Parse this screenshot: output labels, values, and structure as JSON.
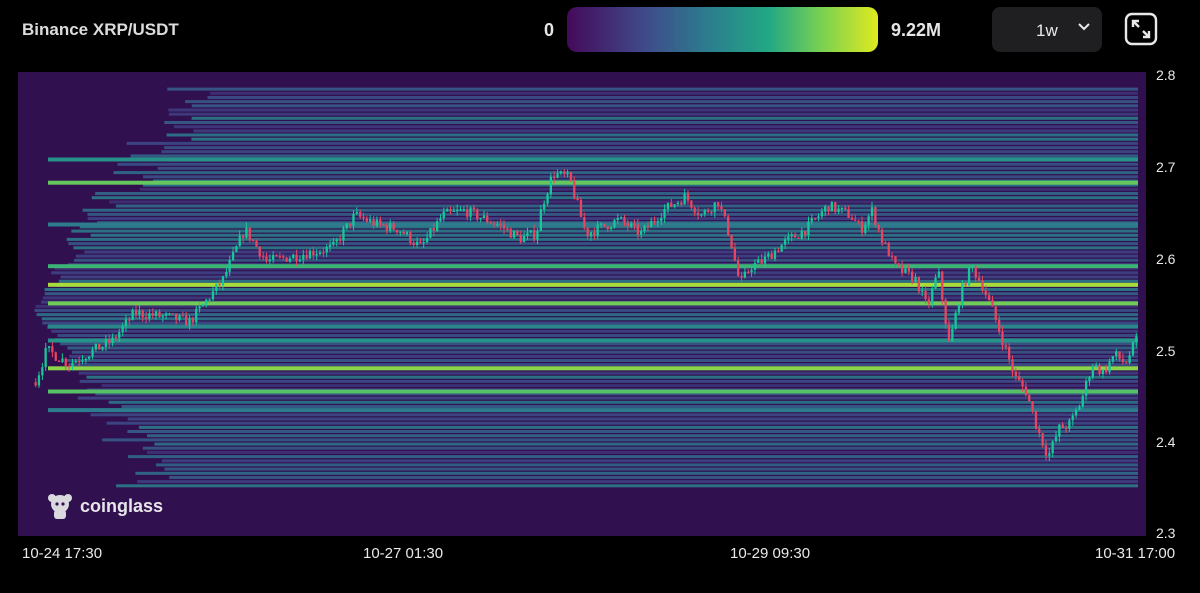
{
  "header": {
    "title": "Binance XRP/USDT",
    "scale_min_label": "0",
    "scale_max_label": "9.22M",
    "range_value": "1w"
  },
  "brand": {
    "logo_text": "coinglass"
  },
  "colors": {
    "background": "#000000",
    "plot_background": "#31104f",
    "candle_up": "#16c79a",
    "candle_down": "#e94560",
    "heat_low": "#440a5a",
    "heat_high": "#e0ea1f"
  },
  "icons": {
    "range_chevron": "chevron-down-icon",
    "fullscreen": "fullscreen-icon",
    "logo": "coinglass-logo-icon"
  },
  "chart_data": {
    "type": "heatmap",
    "title": "Binance XRP/USDT",
    "colorscale": {
      "min": 0,
      "max": 9220000,
      "min_label": "0",
      "max_label": "9.22M"
    },
    "ylim": [
      2.3,
      2.8
    ],
    "y_ticks": [
      "2.8",
      "2.7",
      "2.6",
      "2.5",
      "2.4",
      "2.3"
    ],
    "x_ticks": [
      "10-24 17:30",
      "10-27 01:30",
      "10-29 09:30",
      "10-31 17:00"
    ],
    "liquidity_levels": [
      {
        "price": 2.685,
        "intensity": 0.78
      },
      {
        "price": 2.71,
        "intensity": 0.55
      },
      {
        "price": 2.64,
        "intensity": 0.45
      },
      {
        "price": 2.595,
        "intensity": 0.7
      },
      {
        "price": 2.575,
        "intensity": 0.9
      },
      {
        "price": 2.555,
        "intensity": 0.8
      },
      {
        "price": 2.53,
        "intensity": 0.5
      },
      {
        "price": 2.515,
        "intensity": 0.55
      },
      {
        "price": 2.485,
        "intensity": 0.85
      },
      {
        "price": 2.46,
        "intensity": 0.75
      },
      {
        "price": 2.44,
        "intensity": 0.45
      }
    ],
    "price_path": [
      [
        0,
        2.47
      ],
      [
        0.01,
        2.505
      ],
      [
        0.03,
        2.49
      ],
      [
        0.07,
        2.515
      ],
      [
        0.09,
        2.545
      ],
      [
        0.12,
        2.54
      ],
      [
        0.14,
        2.535
      ],
      [
        0.17,
        2.58
      ],
      [
        0.19,
        2.635
      ],
      [
        0.21,
        2.6
      ],
      [
        0.25,
        2.61
      ],
      [
        0.27,
        2.615
      ],
      [
        0.29,
        2.65
      ],
      [
        0.31,
        2.64
      ],
      [
        0.33,
        2.635
      ],
      [
        0.35,
        2.615
      ],
      [
        0.37,
        2.65
      ],
      [
        0.39,
        2.655
      ],
      [
        0.42,
        2.64
      ],
      [
        0.44,
        2.625
      ],
      [
        0.455,
        2.63
      ],
      [
        0.46,
        2.66
      ],
      [
        0.47,
        2.695
      ],
      [
        0.485,
        2.69
      ],
      [
        0.5,
        2.63
      ],
      [
        0.53,
        2.645
      ],
      [
        0.55,
        2.63
      ],
      [
        0.57,
        2.655
      ],
      [
        0.59,
        2.67
      ],
      [
        0.605,
        2.65
      ],
      [
        0.62,
        2.665
      ],
      [
        0.63,
        2.63
      ],
      [
        0.64,
        2.575
      ],
      [
        0.65,
        2.595
      ],
      [
        0.66,
        2.6
      ],
      [
        0.68,
        2.62
      ],
      [
        0.7,
        2.635
      ],
      [
        0.72,
        2.66
      ],
      [
        0.74,
        2.65
      ],
      [
        0.75,
        2.635
      ],
      [
        0.76,
        2.655
      ],
      [
        0.77,
        2.62
      ],
      [
        0.775,
        2.61
      ],
      [
        0.78,
        2.595
      ],
      [
        0.8,
        2.58
      ],
      [
        0.81,
        2.55
      ],
      [
        0.82,
        2.59
      ],
      [
        0.83,
        2.51
      ],
      [
        0.84,
        2.565
      ],
      [
        0.85,
        2.595
      ],
      [
        0.86,
        2.575
      ],
      [
        0.87,
        2.545
      ],
      [
        0.88,
        2.51
      ],
      [
        0.89,
        2.475
      ],
      [
        0.9,
        2.46
      ],
      [
        0.91,
        2.42
      ],
      [
        0.92,
        2.39
      ],
      [
        0.93,
        2.42
      ],
      [
        0.94,
        2.425
      ],
      [
        0.95,
        2.45
      ],
      [
        0.96,
        2.49
      ],
      [
        0.97,
        2.48
      ],
      [
        0.98,
        2.5
      ],
      [
        0.99,
        2.49
      ],
      [
        1.0,
        2.515
      ]
    ]
  }
}
